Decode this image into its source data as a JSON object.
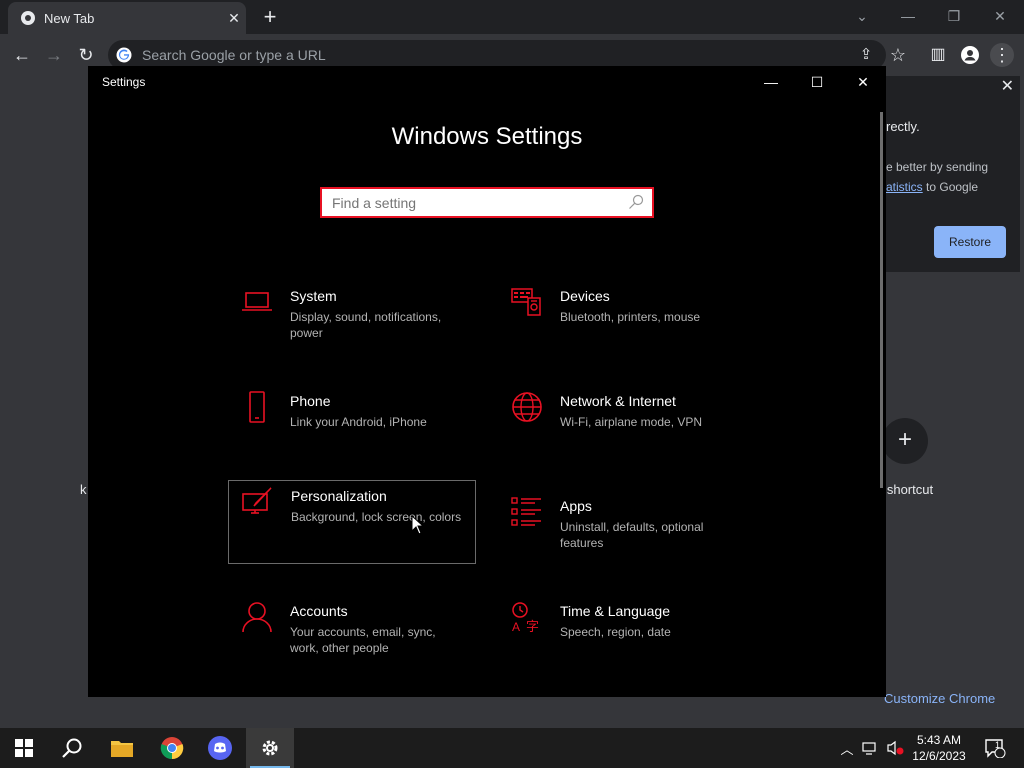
{
  "chrome": {
    "tab_title": "New Tab",
    "tab_close": "✕",
    "new_tab": "+",
    "omnibox_placeholder": "Search Google or type a URL",
    "restore_card": {
      "line1": "rectly.",
      "line2": "e better by sending",
      "line3_link": "atistics",
      "line3_rest": " to Google",
      "close": "✕",
      "button": "Restore"
    },
    "add_shortcut_symbol": "+",
    "add_shortcut_label": "d shortcut",
    "left_fragment": "k",
    "customize_label": "Customize Chrome"
  },
  "settings": {
    "window_title": "Settings",
    "heading": "Windows Settings",
    "search_placeholder": "Find a setting",
    "accent_color": "#e81123",
    "tiles": [
      {
        "name": "System",
        "desc": "Display, sound, notifications, power",
        "icon": "laptop-icon"
      },
      {
        "name": "Devices",
        "desc": "Bluetooth, printers, mouse",
        "icon": "devices-icon"
      },
      {
        "name": "Phone",
        "desc": "Link your Android, iPhone",
        "icon": "phone-icon"
      },
      {
        "name": "Network & Internet",
        "desc": "Wi-Fi, airplane mode, VPN",
        "icon": "globe-icon"
      },
      {
        "name": "Personalization",
        "desc": "Background, lock screen, colors",
        "icon": "paint-icon"
      },
      {
        "name": "Apps",
        "desc": "Uninstall, defaults, optional features",
        "icon": "apps-list-icon"
      },
      {
        "name": "Accounts",
        "desc": "Your accounts, email, sync, work, other people",
        "icon": "person-icon"
      },
      {
        "name": "Time & Language",
        "desc": "Speech, region, date",
        "icon": "time-language-icon"
      }
    ]
  },
  "taskbar": {
    "time": "5:43 AM",
    "date": "12/6/2023",
    "notification_count": "1"
  }
}
